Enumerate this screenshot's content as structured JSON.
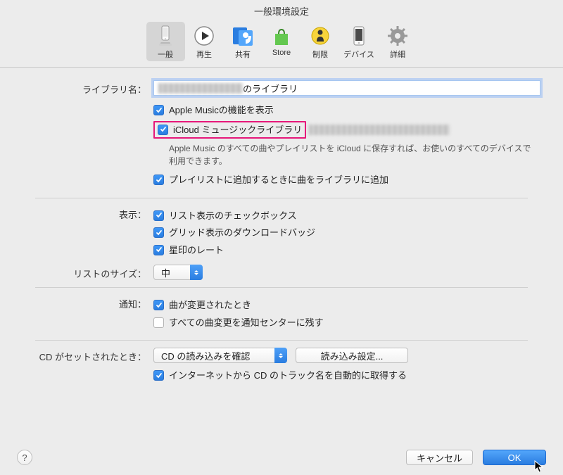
{
  "window": {
    "title": "一般環境設定"
  },
  "toolbar": {
    "general": "一般",
    "playback": "再生",
    "sharing": "共有",
    "store": "Store",
    "restrictions": "制限",
    "devices": "デバイス",
    "advanced": "詳細"
  },
  "labels": {
    "library_name": "ライブラリ名：",
    "display": "表示：",
    "list_size": "リストのサイズ：",
    "notifications": "通知：",
    "cd_insert": "CD がセットされたとき："
  },
  "library": {
    "suffix": " のライブラリ"
  },
  "checkboxes": {
    "apple_music": "Apple Musicの機能を表示",
    "icloud_library": "iCloud ミュージックライブラリ",
    "icloud_desc": "Apple Music のすべての曲やプレイリストを iCloud に保存すれば、お使いのすべてのデバイスで利用できます。",
    "playlist_add": "プレイリストに追加するときに曲をライブラリに追加",
    "list_checkbox": "リスト表示のチェックボックス",
    "grid_badges": "グリッド表示のダウンロードバッジ",
    "star_ratings": "星印のレート",
    "notify_changed": "曲が変更されたとき",
    "notify_center": "すべての曲変更を通知センターに残す",
    "cd_track_names": "インターネットから CD のトラック名を自動的に取得する"
  },
  "selects": {
    "list_size_value": "中",
    "cd_action_value": "CD の読み込みを確認"
  },
  "buttons": {
    "import_settings": "読み込み設定...",
    "cancel": "キャンセル",
    "ok": "OK"
  }
}
